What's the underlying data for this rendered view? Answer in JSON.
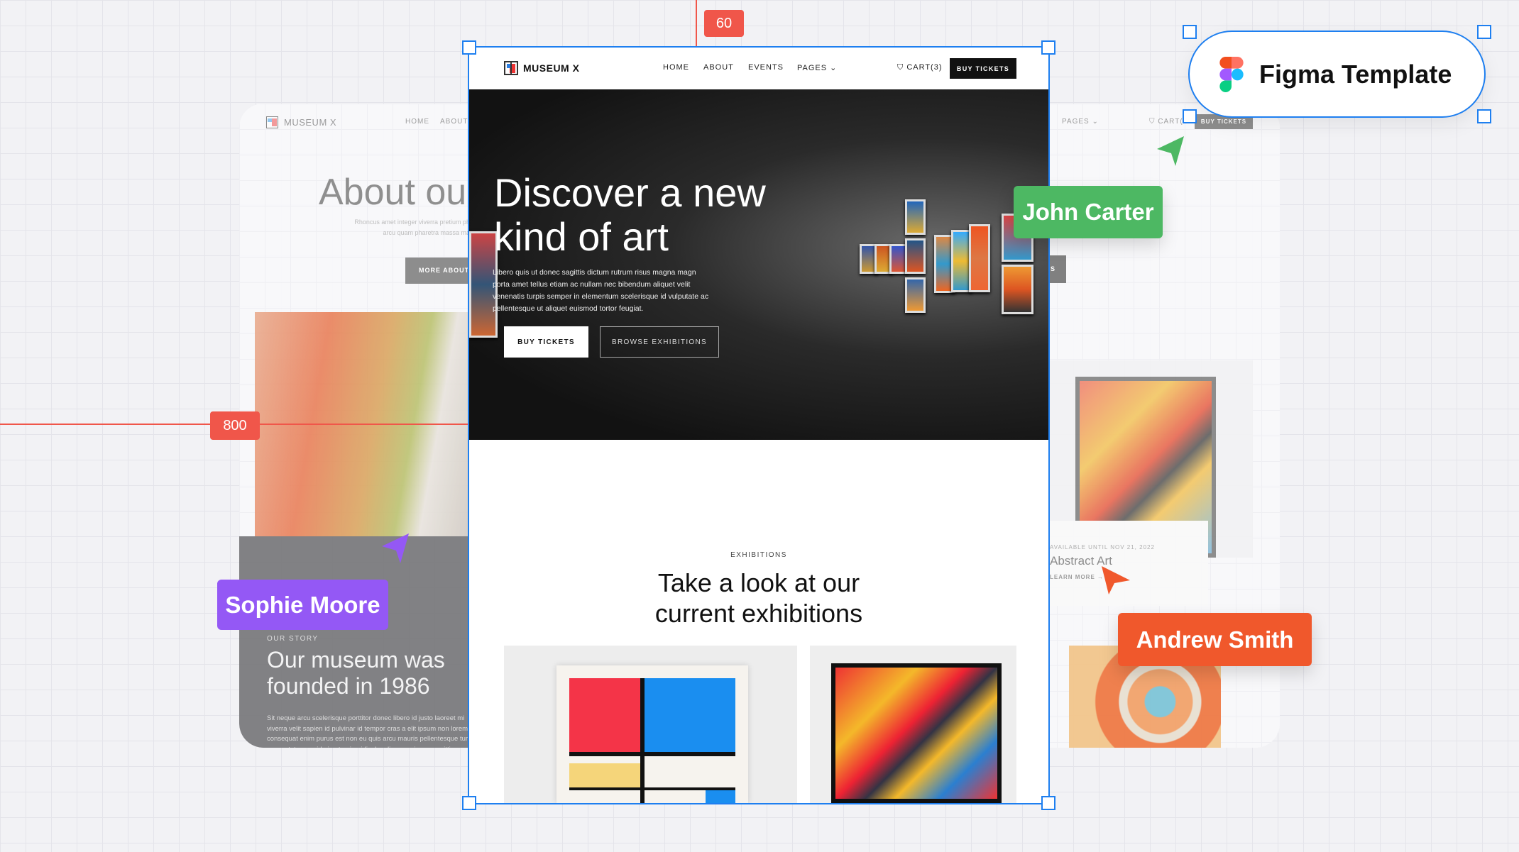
{
  "brand": "MUSEUM X",
  "nav": {
    "home": "HOME",
    "about": "ABOUT",
    "events": "EVENTS",
    "pages": "PAGES",
    "cart": "CART(3)",
    "buy": "BUY TICKETS"
  },
  "hero": {
    "title_1": "Discover a new",
    "title_2": "kind of art",
    "body": "Libero quis ut donec sagittis dictum rutrum risus magna magn porta amet tellus etiam ac nullam nec bibendum aliquet velit venenatis turpis semper in elementum scelerisque id vulputate ac pellentesque ut aliquet euismod tortor feugiat.",
    "buy": "BUY TICKETS",
    "browse": "BROWSE EXHIBITIONS"
  },
  "exhibitions": {
    "eyebrow": "EXHIBITIONS",
    "title_1": "Take a look at our",
    "title_2": "current exhibitions"
  },
  "about_page": {
    "title": "About ou",
    "sub_1": "Rhoncus amet integer viverra pretium pha",
    "sub_2": "arcu quam pharetra massa mae",
    "button": "MORE ABOUT U",
    "story_eyebrow": "OUR STORY",
    "story_title_1": "Our museum was",
    "story_title_2": "founded in 1986",
    "story_body": "Sit neque arcu scelerisque porttitor donec libero id justo laoreet mi viverra velit sapien id pulvinar id tempor cras a elit ipsum non lorem consequat enim purus est non eu quis arcu mauris pellentesque turp consectetur gravida in at enim ridiculus diam ac viverra sagittis"
  },
  "right_page": {
    "pages": "PAGES",
    "cart": "CART(",
    "buy": "BUY TICKETS",
    "btn_fragment": "S",
    "available": "AVAILABLE UNTIL NOV 21, 2022",
    "card_title": "Abstract Art",
    "learn": "LEARN MORE →"
  },
  "figma": {
    "label": "Figma Template"
  },
  "rulers": {
    "top": "60",
    "left": "800"
  },
  "collaborators": [
    {
      "name": "John Carter",
      "color": "#4db863"
    },
    {
      "name": "Sophie Moore",
      "color": "#9458f5"
    },
    {
      "name": "Andrew Smith",
      "color": "#f0582c"
    }
  ],
  "colors": {
    "selection": "#1e7ff0",
    "ruler": "#f0564a"
  }
}
